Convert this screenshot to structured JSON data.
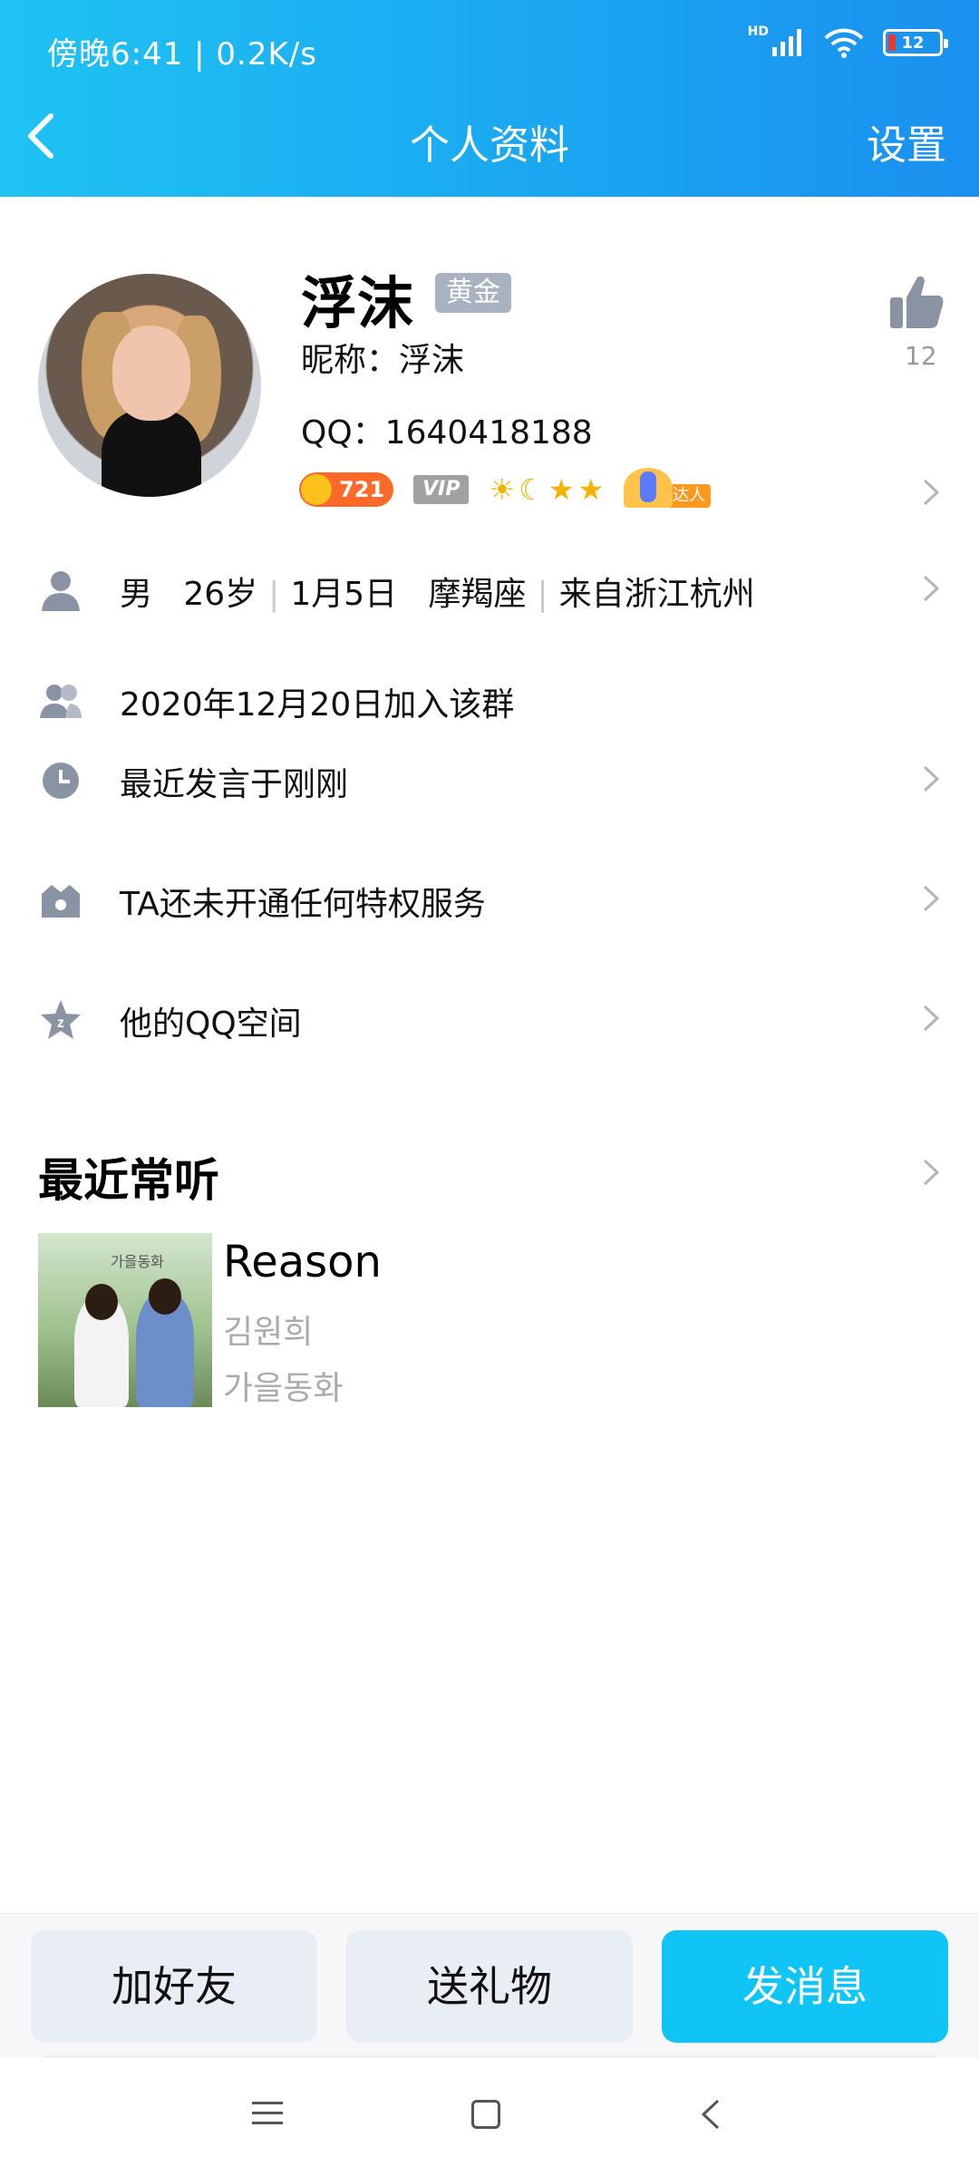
{
  "status_bar": {
    "time": "傍晚6:41 | 0.2K/s",
    "network_label": "HD",
    "battery": "12"
  },
  "nav": {
    "title": "个人资料",
    "settings": "设置"
  },
  "profile": {
    "name": "浮沫",
    "badge": "黄金",
    "nickname": "昵称：浮沫",
    "qq": "QQ：1640418188",
    "likes": "12",
    "level": "721",
    "vip": "VIP",
    "daren_tag": "达人"
  },
  "info": {
    "gender": "男",
    "age": "26岁",
    "birthday": "1月5日",
    "zodiac": "摩羯座",
    "location": "来自浙江杭州",
    "joined": "2020年12月20日加入该群",
    "last_spoke": "最近发言于刚刚",
    "privilege": "TA还未开通任何特权服务",
    "qzone": "他的QQ空间"
  },
  "music": {
    "section_title": "最近常听",
    "song": "Reason",
    "artist": "김원희",
    "album": "가을동화",
    "album_caption": "가을동화"
  },
  "actions": {
    "add_friend": "加好友",
    "send_gift": "送礼物",
    "send_message": "发消息"
  },
  "colors": {
    "header_start": "#1fc3f3",
    "header_end": "#1a90ef",
    "primary_button": "#0fc5f5",
    "secondary_button": "#e9edf4"
  }
}
